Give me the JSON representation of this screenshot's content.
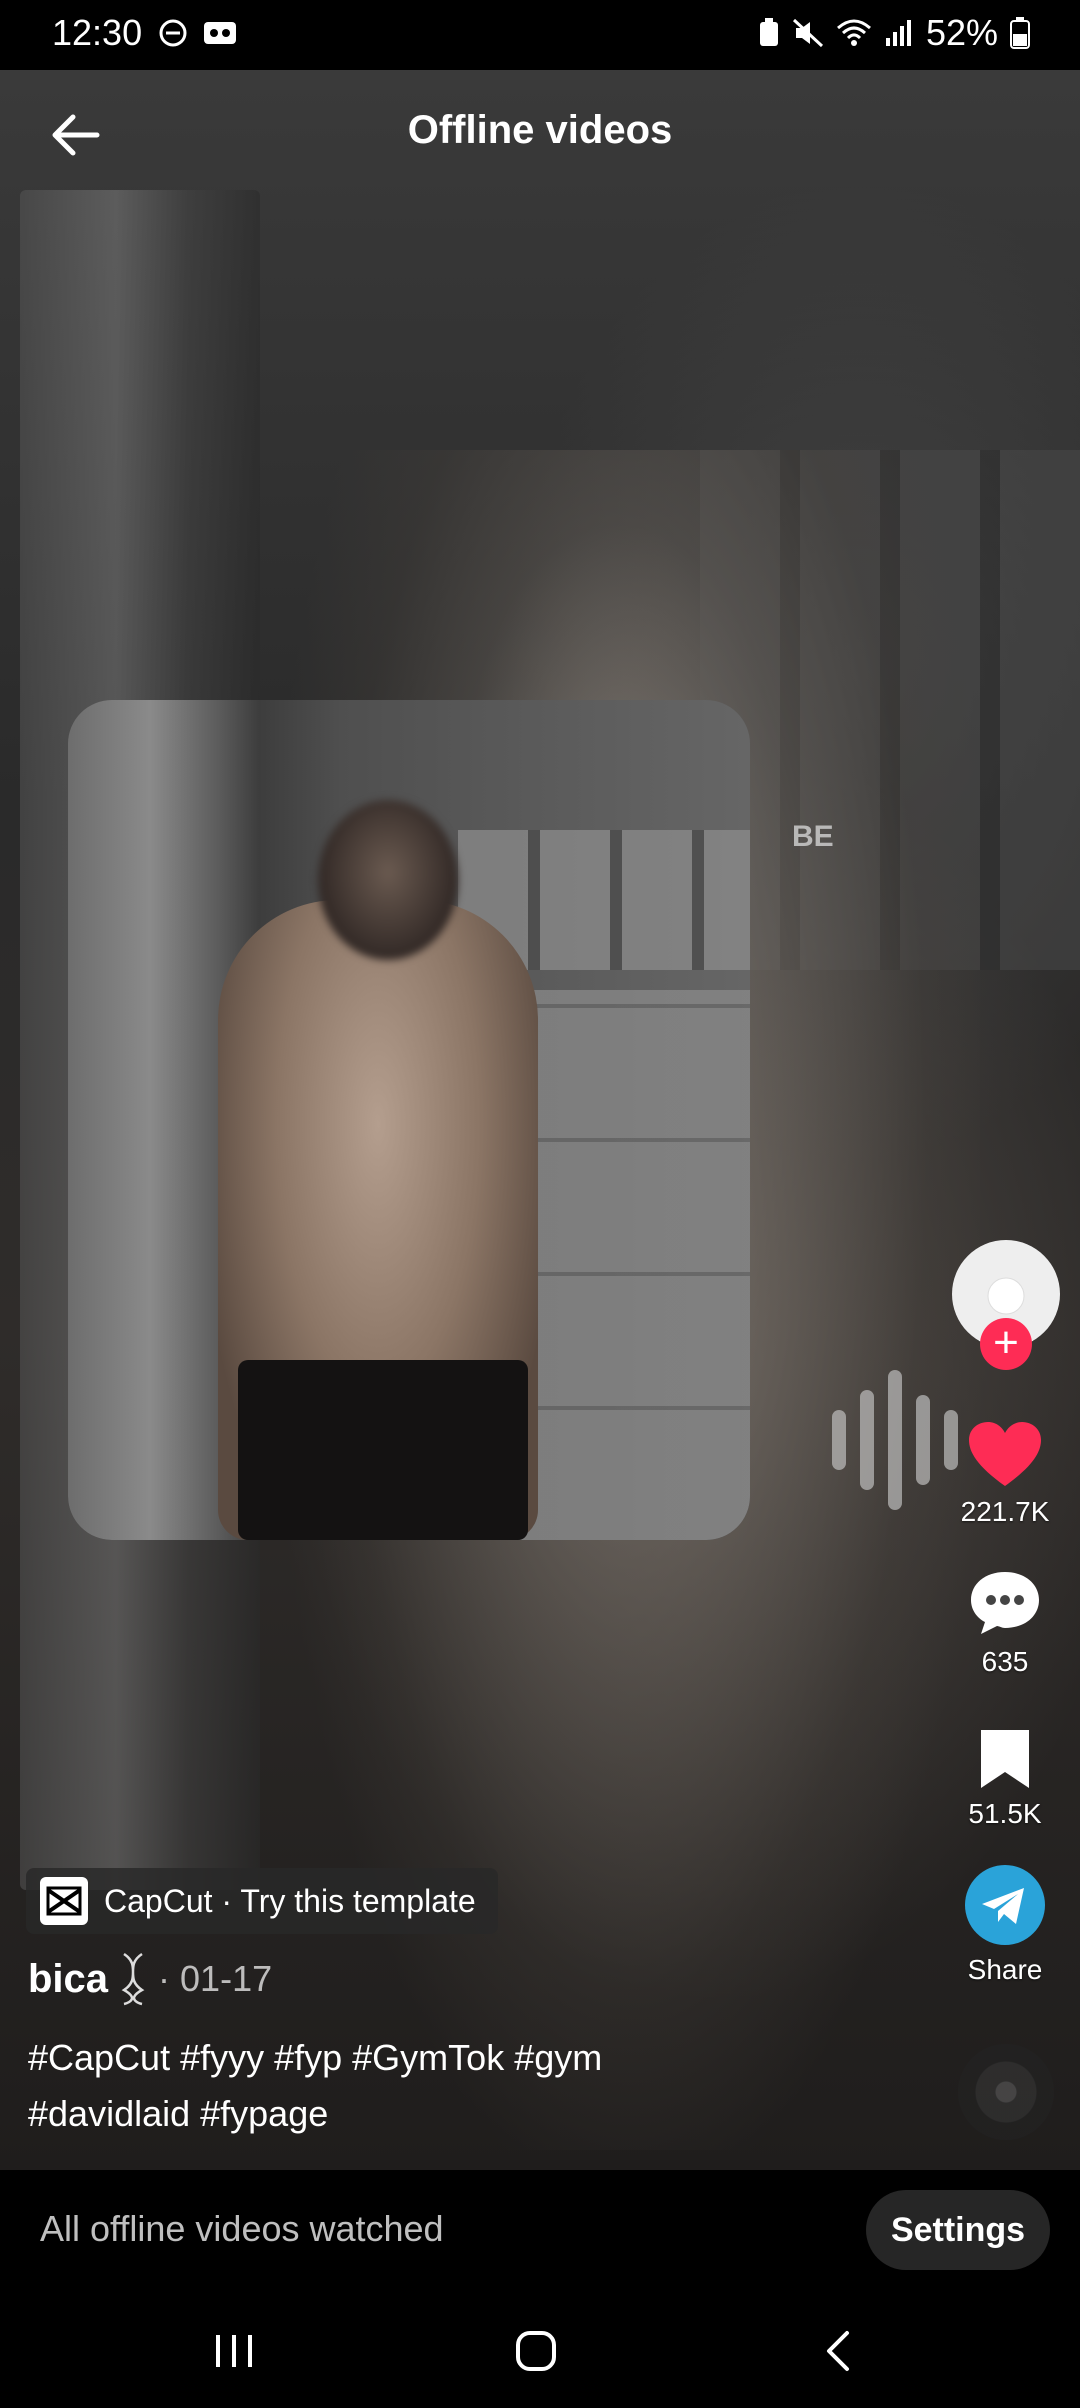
{
  "status_bar": {
    "time": "12:30",
    "battery": "52%"
  },
  "header": {
    "title": "Offline videos"
  },
  "overlay_text": "BE",
  "actions": {
    "likes": "221.7K",
    "comments": "635",
    "saves": "51.5K",
    "share_label": "Share"
  },
  "post": {
    "template_chip": "CapCut · Try this template",
    "author": "bica",
    "date": "· 01-17",
    "caption_line1": "#CapCut #fyyy #fyp #GymTok #gym",
    "caption_line2": "#davidlaid #fypage"
  },
  "bottom_bar": {
    "message": "All offline videos watched",
    "settings_label": "Settings"
  },
  "colors": {
    "like_red": "#fe2c55",
    "share_blue": "#2aa3d9"
  }
}
